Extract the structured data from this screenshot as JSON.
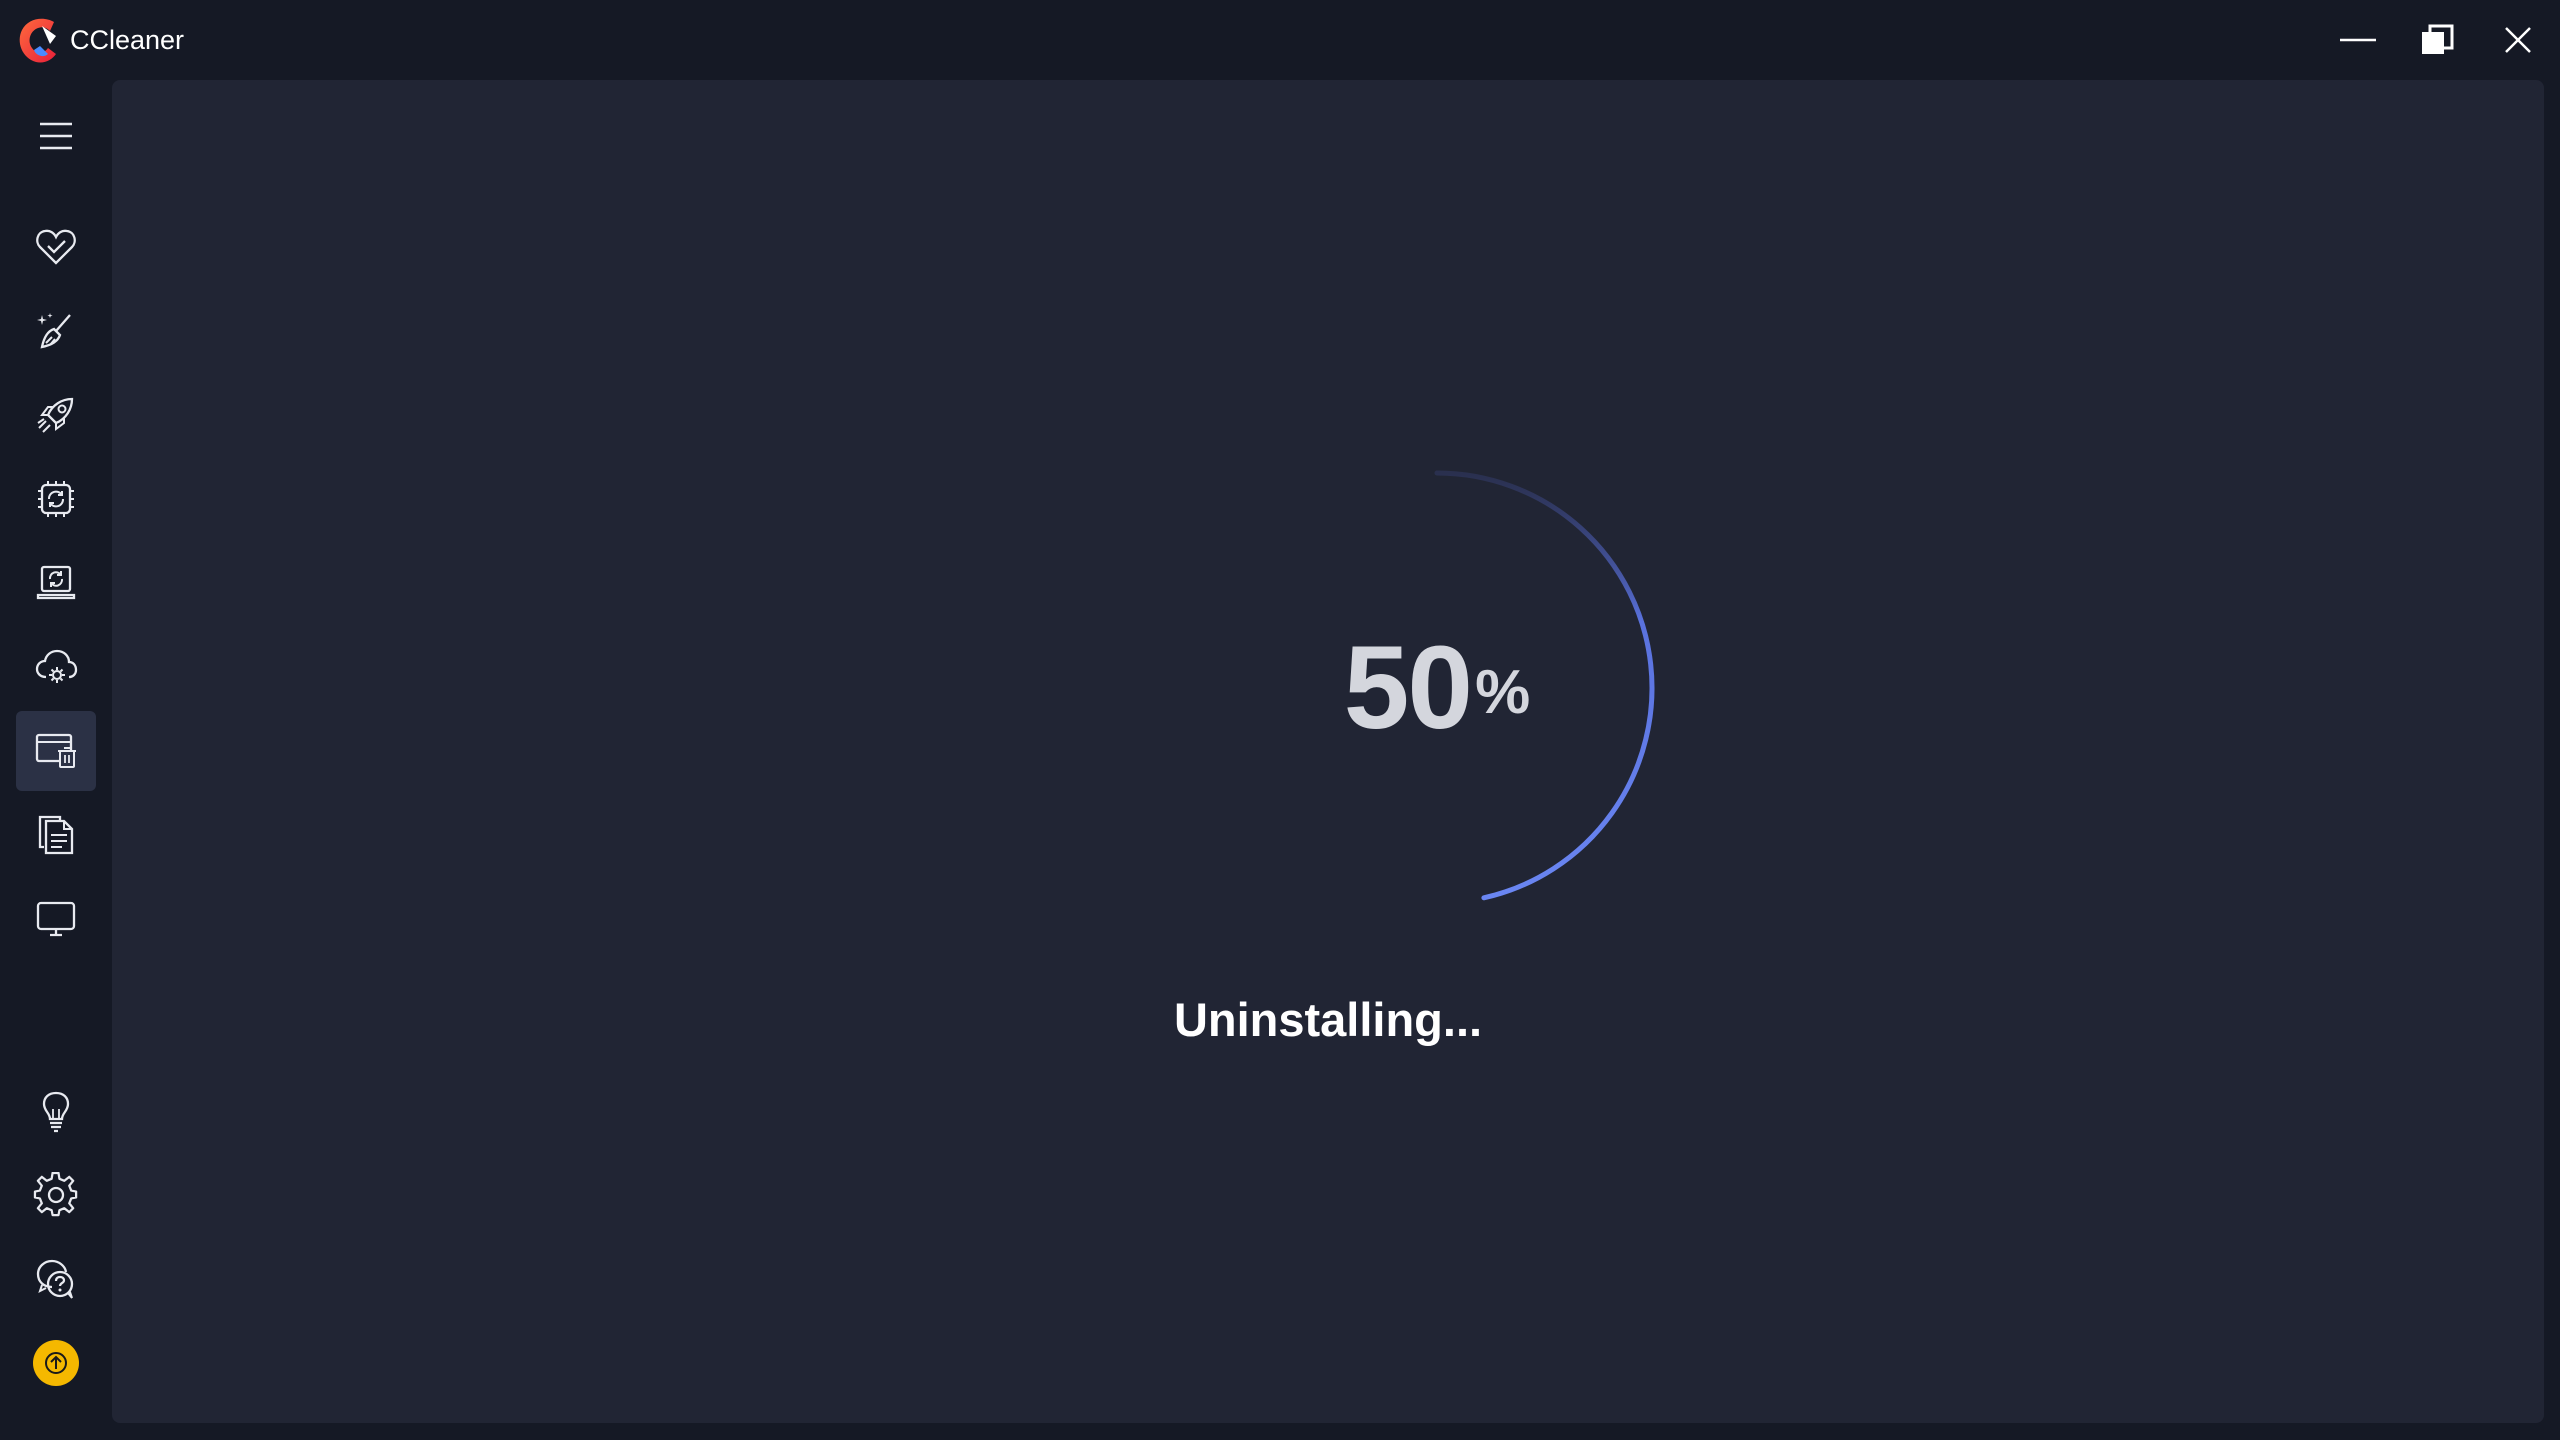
{
  "app": {
    "title": "CCleaner"
  },
  "window_controls": {
    "minimize_icon": "minimize-icon",
    "restore_icon": "restore-icon",
    "close_icon": "close-icon"
  },
  "sidebar": {
    "items": [
      {
        "icon": "menu-icon"
      },
      {
        "icon": "heart-check-icon"
      },
      {
        "icon": "broom-sparkle-icon"
      },
      {
        "icon": "rocket-icon"
      },
      {
        "icon": "chip-refresh-icon"
      },
      {
        "icon": "laptop-update-icon"
      },
      {
        "icon": "cloud-gear-icon"
      },
      {
        "icon": "uninstaller-icon",
        "active": true
      },
      {
        "icon": "documents-icon"
      },
      {
        "icon": "monitor-icon"
      },
      {
        "icon": "lightbulb-icon"
      },
      {
        "icon": "settings-gear-icon"
      },
      {
        "icon": "help-chat-icon"
      },
      {
        "icon": "upgrade-icon"
      }
    ]
  },
  "progress": {
    "value": "50",
    "unit": "%",
    "fraction": 0.5
  },
  "status": {
    "text": "Uninstalling..."
  },
  "colors": {
    "background": "#151925",
    "panel": "#212534",
    "accent": "#5b77e6",
    "upgrade": "#f5b800",
    "active_nav": "#2b3145"
  }
}
